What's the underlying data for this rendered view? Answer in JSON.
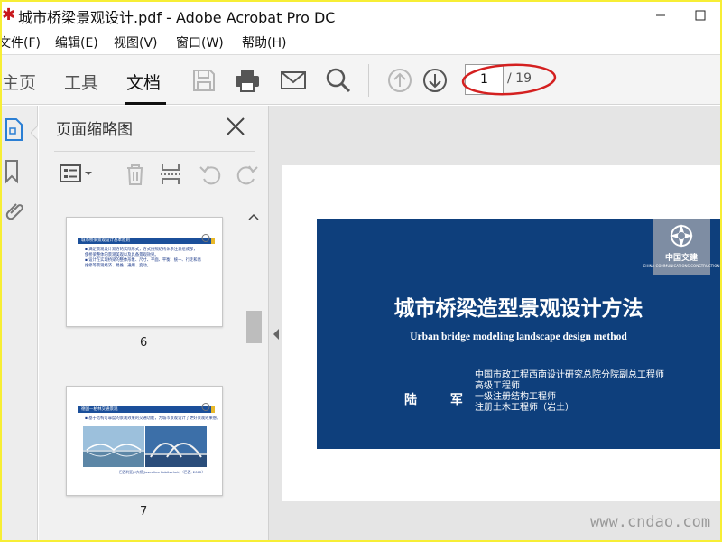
{
  "window": {
    "title": "城市桥梁景观设计.pdf - Adobe Acrobat Pro DC"
  },
  "menu": [
    {
      "label": "文件(F)"
    },
    {
      "label": "编辑(E)"
    },
    {
      "label": "视图(V)"
    },
    {
      "label": "窗口(W)"
    },
    {
      "label": "帮助(H)"
    }
  ],
  "toolbar": {
    "tabs": [
      {
        "label": "主页"
      },
      {
        "label": "工具"
      },
      {
        "label": "文档"
      }
    ],
    "active_tab": "文档",
    "icons": [
      "save-icon",
      "print-icon",
      "mail-icon",
      "search-icon",
      "arrow-up-icon",
      "arrow-down-icon"
    ],
    "page_current": "1",
    "page_total": "/ 19"
  },
  "left_rail": {
    "icons": [
      "page-thumbnails-icon",
      "bookmark-icon",
      "attachment-icon"
    ]
  },
  "thumbnail_panel": {
    "title": "页面缩略图",
    "tools": [
      "options-menu-icon",
      "delete-icon",
      "extract-icon",
      "rotate-left-icon",
      "rotate-right-icon"
    ],
    "thumbnails": [
      {
        "number": "6",
        "header": "城市桥梁景观设计基本原则",
        "lines": [
          "▪ 满足景观设计双方的实际形式，方式按照结构体系注意组成部，",
          "  使桥梁整体的景观美观以及具备景观效果。",
          "▪ 设计在实现桥梁的整体形象、尺寸、平面、平衡、统一、行走和易",
          "  维修等景观经济、易维、通用、变动。"
        ]
      },
      {
        "number": "7",
        "header": "德国—柏林交通景观",
        "lines": [
          "▪ 基于结构可靠度的景观效果的交通功能，为城市景观设计了更好景观效果感。"
        ],
        "caption": "巴西利亚JK大桥(Juscelino Kubitschek)（巴西, 2002）"
      }
    ]
  },
  "document": {
    "slide": {
      "title": "城市桥梁造型景观设计方法",
      "subtitle": "Urban bridge modeling landscape design method",
      "author": "陆 军",
      "credits": [
        "中国市政工程西南设计研究总院分院副总工程师",
        "高级工程师",
        "一级注册结构工程师",
        "注册土木工程师（岩土）"
      ],
      "logo_text": "中国交建",
      "logo_subtext": "CHINA COMMUNICATIONS CONSTRUCTION",
      "background_color": "#0e3f7c"
    }
  },
  "watermark": "www.cndao.com",
  "colors": {
    "frame": "#f7ee35",
    "annotation": "#d42020",
    "active_icon": "#2b7fd4"
  }
}
